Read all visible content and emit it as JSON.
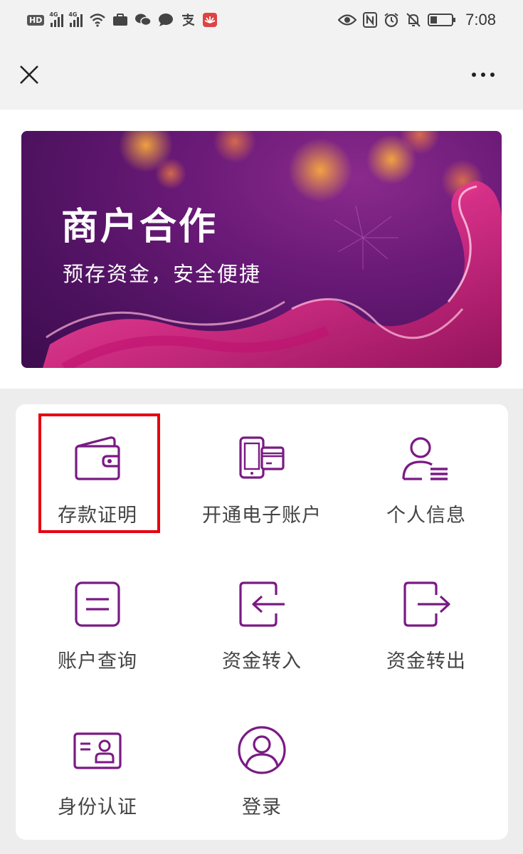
{
  "status_bar": {
    "time": "7:08",
    "hd_label": "HD",
    "network_label": "4G"
  },
  "banner": {
    "title": "商户合作",
    "subtitle": "预存资金，安全便捷"
  },
  "menu": {
    "items": [
      {
        "label": "存款证明",
        "icon": "wallet-icon"
      },
      {
        "label": "开通电子账户",
        "icon": "phone-card-icon"
      },
      {
        "label": "个人信息",
        "icon": "person-list-icon"
      },
      {
        "label": "账户查询",
        "icon": "document-lines-icon"
      },
      {
        "label": "资金转入",
        "icon": "transfer-in-icon"
      },
      {
        "label": "资金转出",
        "icon": "transfer-out-icon"
      },
      {
        "label": "身份认证",
        "icon": "id-card-icon"
      },
      {
        "label": "登录",
        "icon": "user-circle-icon"
      }
    ],
    "highlighted_item": "存款证明"
  },
  "colors": {
    "accent": "#7a1a84",
    "highlight_border": "#e60012",
    "page_bg": "#ededed",
    "card_bg": "#ffffff"
  }
}
